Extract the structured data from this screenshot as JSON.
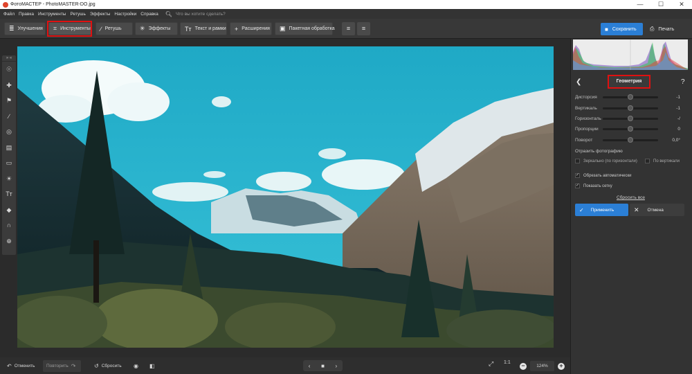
{
  "window": {
    "title": "ФотоМАСТЕР - PhotoMASTER-DO.jpg",
    "controls": [
      "—",
      "☐",
      "✕"
    ]
  },
  "menu": {
    "items": [
      "Файл",
      "Правка",
      "Инструменты",
      "Ретушь",
      "Эффекты",
      "Настройки",
      "Справка"
    ],
    "search_placeholder": "Что вы хотите сделать?"
  },
  "toolbar": {
    "tabs": [
      {
        "label": "Улучшения",
        "icon": "sliders-icon"
      },
      {
        "label": "Инструменты",
        "icon": "crop-icon"
      },
      {
        "label": "Ретушь",
        "icon": "brush-icon"
      },
      {
        "label": "Эффекты",
        "icon": "sparkle-icon"
      },
      {
        "label": "Текст и рамки",
        "icon": "text-icon"
      },
      {
        "label": "Расширения",
        "icon": "plus-icon"
      },
      {
        "label": "Пакетная обработка",
        "icon": "batch-icon"
      }
    ],
    "active_tab": "Инструменты",
    "save_label": "Сохранить",
    "print_label": "Печать"
  },
  "left_tools": [
    "stamp-icon",
    "bandage-icon",
    "clone-icon",
    "brush-icon",
    "radial-icon",
    "gradient-icon",
    "vignette-icon",
    "light-icon",
    "text-icon",
    "fill-icon",
    "magnet-icon",
    "globe-icon"
  ],
  "panel": {
    "title": "Геометрия",
    "sliders": [
      {
        "label": "Дисторсия",
        "value": "-1"
      },
      {
        "label": "Вертикаль",
        "value": "-1"
      },
      {
        "label": "Горизонталь",
        "value": "-/"
      },
      {
        "label": "Пропорции",
        "value": "0"
      },
      {
        "label": "Поворот",
        "value": "0,0°"
      }
    ],
    "mirror_section": "Отразить фотографию",
    "mirror_horizontal": "Зеркально (по горизонтали)",
    "mirror_vertical": "По вертикали",
    "auto_crop": "Обрезать автоматически",
    "show_grid": "Показать сетку",
    "reset_all": "Сбросить все",
    "apply": "Применить",
    "cancel": "Отмена"
  },
  "bottom": {
    "undo": "Отменить",
    "redo": "Повторить",
    "reset": "Сбросить",
    "zoom_ratio": "1:1",
    "zoom_value": "124%"
  },
  "colors": {
    "accent": "#2b7fd6",
    "highlight": "#e01010"
  }
}
